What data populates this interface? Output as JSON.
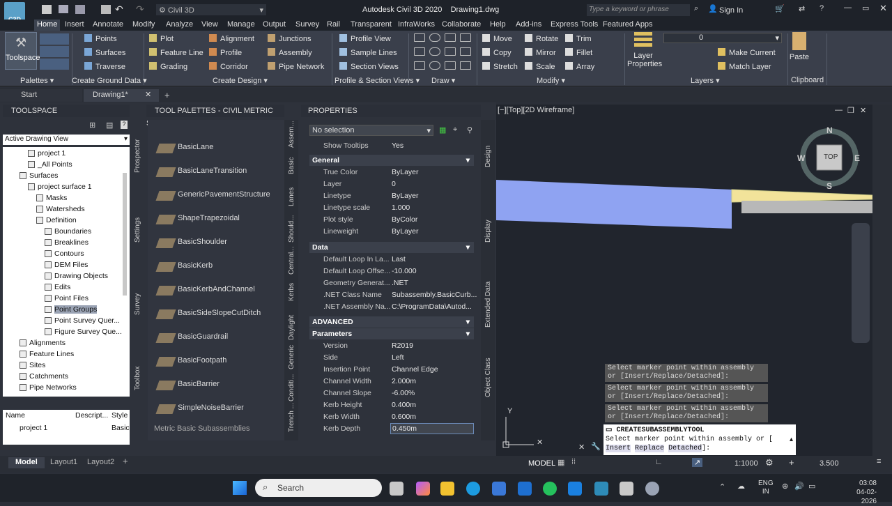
{
  "app": {
    "workspace": "Civil 3D",
    "title": "Autodesk Civil 3D 2020",
    "drawing": "Drawing1.dwg",
    "search_placeholder": "Type a keyword or phrase",
    "sign_in": "Sign In",
    "logo": "C3D"
  },
  "ribbon_tabs": [
    "Home",
    "Insert",
    "Annotate",
    "Modify",
    "Analyze",
    "View",
    "Manage",
    "Output",
    "Survey",
    "Rail",
    "Transparent",
    "InfraWorks",
    "Collaborate",
    "Help",
    "Add-ins",
    "Express Tools",
    "Featured Apps"
  ],
  "ribbon": {
    "toolspace": "Toolspace",
    "ground": [
      "Points",
      "Surfaces",
      "Traverse"
    ],
    "design1": [
      "Plot",
      "Feature Line",
      "Grading"
    ],
    "design2": [
      "Alignment",
      "Profile",
      "Corridor"
    ],
    "design3": [
      "Junctions",
      "Assembly",
      "Pipe Network"
    ],
    "profile": [
      "Profile View",
      "Sample Lines",
      "Section Views"
    ],
    "modify1": [
      "Move",
      "Copy",
      "Stretch"
    ],
    "modify2": [
      "Rotate",
      "Mirror",
      "Scale"
    ],
    "modify3": [
      "Trim",
      "Fillet",
      "Array"
    ],
    "layer_props": [
      "Layer",
      "Properties"
    ],
    "layer_value": "0",
    "layer_cmds": [
      "Make Current",
      "Match Layer"
    ],
    "paste": "Paste",
    "panel_titles": [
      "Palettes",
      "Create Ground Data",
      "Create Design",
      "Profile & Section Views",
      "Draw",
      "Modify",
      "Layers",
      "Clipboard"
    ]
  },
  "doc_tabs": [
    "Start",
    "Drawing1*"
  ],
  "toolspace": {
    "title": "TOOLSPACE",
    "view": "Active Drawing View",
    "tree": [
      "project 1",
      "_All Points",
      "Surfaces",
      "project surface 1",
      "Masks",
      "Watersheds",
      "Definition",
      "Boundaries",
      "Breaklines",
      "Contours",
      "DEM Files",
      "Drawing Objects",
      "Edits",
      "Point Files",
      "Point Groups",
      "Point Survey Quer...",
      "Figure Survey Que...",
      "Alignments",
      "Feature Lines",
      "Sites",
      "Catchments",
      "Pipe Networks"
    ],
    "side_tabs": [
      "Prospector",
      "Settings",
      "Survey",
      "Toolbox"
    ],
    "table_headers": [
      "Name",
      "Descript...",
      "Style"
    ],
    "table_row": [
      "project 1",
      "",
      "Basic"
    ]
  },
  "palettes": {
    "title": "TOOL PALETTES - CIVIL METRIC S...",
    "items": [
      "BasicLane",
      "BasicLaneTransition",
      "GenericPavementStructure",
      "ShapeTrapezoidal",
      "BasicShoulder",
      "BasicKerb",
      "BasicKerbAndChannel",
      "BasicSideSlopeCutDitch",
      "BasicGuardrail",
      "BasicFootpath",
      "BasicBarrier",
      "SimpleNoiseBarrier"
    ],
    "footer": "Metric Basic Subassemblies",
    "side_tabs": [
      "Assem...",
      "Basic",
      "Lanes",
      "Should...",
      "Central...",
      "Kerbs",
      "Daylight",
      "Generic",
      "Conditi...",
      "Trench ..."
    ]
  },
  "properties": {
    "title": "PROPERTIES",
    "selection": "No selection",
    "show_tooltips": [
      "Show Tooltips",
      "Yes"
    ],
    "general_title": "General",
    "general": [
      [
        "True Color",
        "ByLayer"
      ],
      [
        "Layer",
        "0"
      ],
      [
        "Linetype",
        "ByLayer"
      ],
      [
        "Linetype scale",
        "1.000"
      ],
      [
        "Plot style",
        "ByColor"
      ],
      [
        "Lineweight",
        "ByLayer"
      ]
    ],
    "data_title": "Data",
    "data": [
      [
        "Default Loop In La...",
        "Last"
      ],
      [
        "Default Loop Offse...",
        "-10.000"
      ],
      [
        "Geometry Generat...",
        ".NET"
      ],
      [
        ".NET Class Name",
        "Subassembly.BasicCurb..."
      ],
      [
        ".NET Assembly Na...",
        "C:\\ProgramData\\Autod..."
      ]
    ],
    "advanced_title": "ADVANCED",
    "params_title": "Parameters",
    "params": [
      [
        "Version",
        "R2019"
      ],
      [
        "Side",
        "Left"
      ],
      [
        "Insertion Point",
        "Channel Edge"
      ],
      [
        "Channel Width",
        "2.000m"
      ],
      [
        "Channel Slope",
        "-6.00%"
      ],
      [
        "Kerb Height",
        "0.400m"
      ],
      [
        "Kerb Width",
        "0.600m"
      ],
      [
        "Kerb Depth",
        "0.450m"
      ]
    ],
    "side_tabs": [
      "Design",
      "Display",
      "Extended Data",
      "Object Class"
    ]
  },
  "viewport": {
    "label": "[−][Top][2D Wireframe]",
    "compass": {
      "N": "N",
      "S": "S",
      "E": "E",
      "W": "W",
      "top": "TOP"
    },
    "axis_y": "Y",
    "history": [
      "Select marker point within assembly or [Insert/Replace/Detached]:",
      "Select marker point within assembly or [Insert/Replace/Detached]:",
      "Select marker point within assembly or [Insert/Replace/Detached]:"
    ],
    "command": "CREATESUBASSEMBLYTOOL",
    "prompt1": "Select marker point within assembly or [",
    "prompt_opts": [
      "Insert",
      "Replace",
      "Detached"
    ],
    "prompt_end": "]:"
  },
  "status": {
    "tabs": [
      "Model",
      "Layout1",
      "Layout2"
    ],
    "model": "MODEL",
    "scale": "1:1000",
    "value": "3.500"
  },
  "taskbar": {
    "search": "Search",
    "lang1": "ENG",
    "lang2": "IN",
    "time": "03:08",
    "date": "04-02-2026"
  }
}
